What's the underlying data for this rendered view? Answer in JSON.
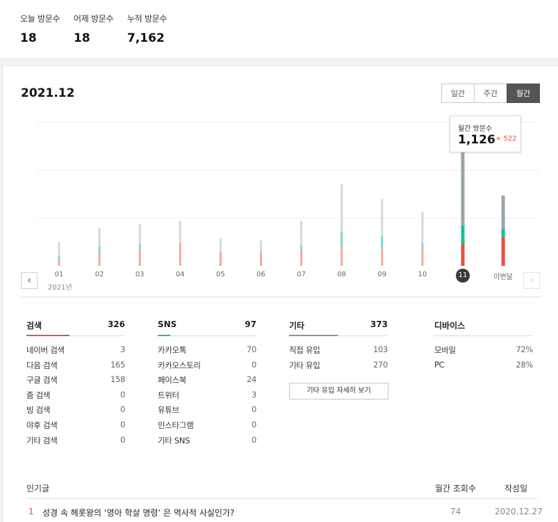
{
  "summary": {
    "today_label": "오늘 방문수",
    "today_value": "18",
    "yesterday_label": "어제 방문수",
    "yesterday_value": "18",
    "total_label": "누적 방문수",
    "total_value": "7,162"
  },
  "period": {
    "title": "2021.12",
    "tabs": [
      {
        "label": "일간",
        "active": false
      },
      {
        "label": "주간",
        "active": false
      },
      {
        "label": "월간",
        "active": true
      }
    ]
  },
  "chart_data": {
    "type": "bar",
    "stacked": true,
    "categories": [
      "01",
      "02",
      "03",
      "04",
      "05",
      "06",
      "07",
      "08",
      "09",
      "10",
      "11",
      "이번달"
    ],
    "year_label": "2021년",
    "selected_category": "11",
    "ylim": [
      0,
      1250
    ],
    "grid": true,
    "legend": "none",
    "series": [
      {
        "color": "#f5a99a",
        "highlight_color": "#ee4d3c",
        "values": [
          50,
          100,
          150,
          200,
          120,
          120,
          130,
          170,
          150,
          160,
          190,
          250
        ]
      },
      {
        "color": "#7ed9c6",
        "highlight_color": "#10c29a",
        "values": [
          40,
          70,
          40,
          0,
          0,
          0,
          50,
          130,
          110,
          40,
          160,
          70
        ]
      },
      {
        "color": "#d3d8dc",
        "highlight_color": "#9aa4ab",
        "values": [
          120,
          160,
          170,
          190,
          120,
          100,
          210,
          410,
          320,
          270,
          776,
          290
        ]
      }
    ],
    "tooltip": {
      "label": "월간 방문수",
      "value": "1,126",
      "delta": "+ 522"
    }
  },
  "nav": {
    "prev_icon": "‹",
    "next_icon": "›"
  },
  "categories": {
    "search": {
      "title": "검색",
      "total": "326",
      "color": "#e9523f",
      "rows": [
        {
          "label": "네이버 검색",
          "value": "3"
        },
        {
          "label": "다음 검색",
          "value": "165"
        },
        {
          "label": "구글 검색",
          "value": "158"
        },
        {
          "label": "줌 검색",
          "value": "0"
        },
        {
          "label": "빙 검색",
          "value": "0"
        },
        {
          "label": "야후 검색",
          "value": "0"
        },
        {
          "label": "기타 검색",
          "value": "0"
        }
      ]
    },
    "sns": {
      "title": "SNS",
      "total": "97",
      "color": "#10c29a",
      "rows": [
        {
          "label": "카카오톡",
          "value": "70"
        },
        {
          "label": "카카오스토리",
          "value": "0"
        },
        {
          "label": "페이스북",
          "value": "24"
        },
        {
          "label": "트위터",
          "value": "3"
        },
        {
          "label": "유튜브",
          "value": "0"
        },
        {
          "label": "인스타그램",
          "value": "0"
        },
        {
          "label": "기타 SNS",
          "value": "0"
        }
      ]
    },
    "etc": {
      "title": "기타",
      "total": "373",
      "color": "#8a949b",
      "rows": [
        {
          "label": "직접 유입",
          "value": "103"
        },
        {
          "label": "기타 유입",
          "value": "270"
        }
      ],
      "detail_button": "기타 유입 자세히 보기"
    },
    "device": {
      "title": "디바이스",
      "rows": [
        {
          "label": "모바일",
          "value": "72%"
        },
        {
          "label": "PC",
          "value": "28%"
        }
      ]
    }
  },
  "popular": {
    "header_title": "인기글",
    "header_views": "월간 조회수",
    "header_date": "작성일",
    "posts": [
      {
        "rank": "1",
        "title": "성경 속 헤롯왕의 ‘영아 학살 명령’ 은 역사적 사실인가?",
        "views": "74",
        "date": "2020.12.27"
      }
    ]
  }
}
